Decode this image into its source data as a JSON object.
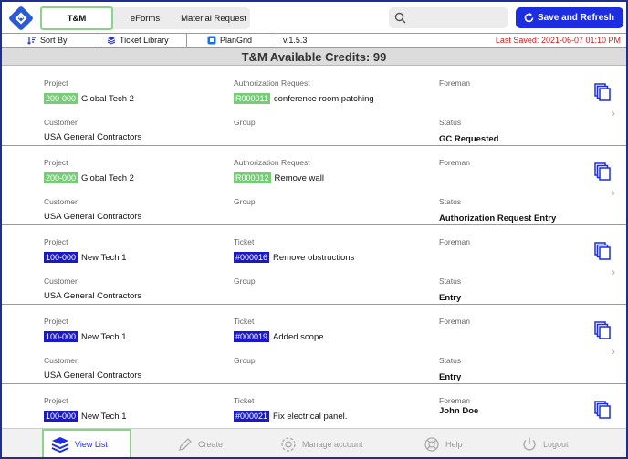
{
  "tabs": [
    {
      "label": "T&M"
    },
    {
      "label": "eForms"
    },
    {
      "label": "Material Request"
    }
  ],
  "search": {
    "placeholder": ""
  },
  "header": {
    "save_label": "Save and Refresh"
  },
  "toolbar": {
    "sort_label": "Sort By",
    "ticket_library_label": "Ticket Library",
    "plangrid_label": "PlanGrid",
    "version": "v.1.5.3",
    "last_saved": "Last Saved: 2021-06-07 01:10 PM"
  },
  "banner": {
    "credits": "T&M Available Credits: 99"
  },
  "labels": {
    "project": "Project",
    "customer": "Customer",
    "group": "Group",
    "foreman": "Foreman",
    "status": "Status",
    "authorization_request": "Authorization Request",
    "ticket": "Ticket"
  },
  "cards": [
    {
      "project_code": "200-000",
      "project_name": "Global Tech 2",
      "ref_label": "Authorization Request",
      "ref_code": "R000011",
      "ref_title": "conference room patching",
      "customer": "USA General Contractors",
      "group": "",
      "foreman": "",
      "status": "GC Requested",
      "badge": "green"
    },
    {
      "project_code": "200-000",
      "project_name": "Global Tech 2",
      "ref_label": "Authorization Request",
      "ref_code": "R000012",
      "ref_title": "Remove wall",
      "customer": "USA General Contractors",
      "group": "",
      "foreman": "",
      "status": "Authorization Request Entry",
      "badge": "green"
    },
    {
      "project_code": "100-000",
      "project_name": "New Tech 1",
      "ref_label": "Ticket",
      "ref_code": "#000016",
      "ref_title": "Remove obstructions",
      "customer": "USA General Contractors",
      "group": "",
      "foreman": "",
      "status": "Entry",
      "badge": "blue"
    },
    {
      "project_code": "100-000",
      "project_name": "New Tech 1",
      "ref_label": "Ticket",
      "ref_code": "#000019",
      "ref_title": "Added scope",
      "customer": "USA General Contractors",
      "group": "",
      "foreman": "",
      "status": "Entry",
      "badge": "blue"
    },
    {
      "project_code": "100-000",
      "project_name": "New Tech 1",
      "ref_label": "Ticket",
      "ref_code": "#000021",
      "ref_title": "Fix electrical panel.",
      "customer": "",
      "group": "",
      "foreman": "John Doe",
      "status": "",
      "badge": "blue"
    }
  ],
  "bottom_nav": [
    {
      "label": "View List",
      "icon": "stack-icon"
    },
    {
      "label": "Create",
      "icon": "pencil-icon"
    },
    {
      "label": "Manage account",
      "icon": "gear-icon"
    },
    {
      "label": "Help",
      "icon": "lifebuoy-icon"
    },
    {
      "label": "Logout",
      "icon": "power-icon"
    }
  ],
  "colors": {
    "accent": "#1d2ee0",
    "green_badge": "#77cc77",
    "blue_badge": "#1a18c9",
    "last_saved": "#d01b1b"
  }
}
